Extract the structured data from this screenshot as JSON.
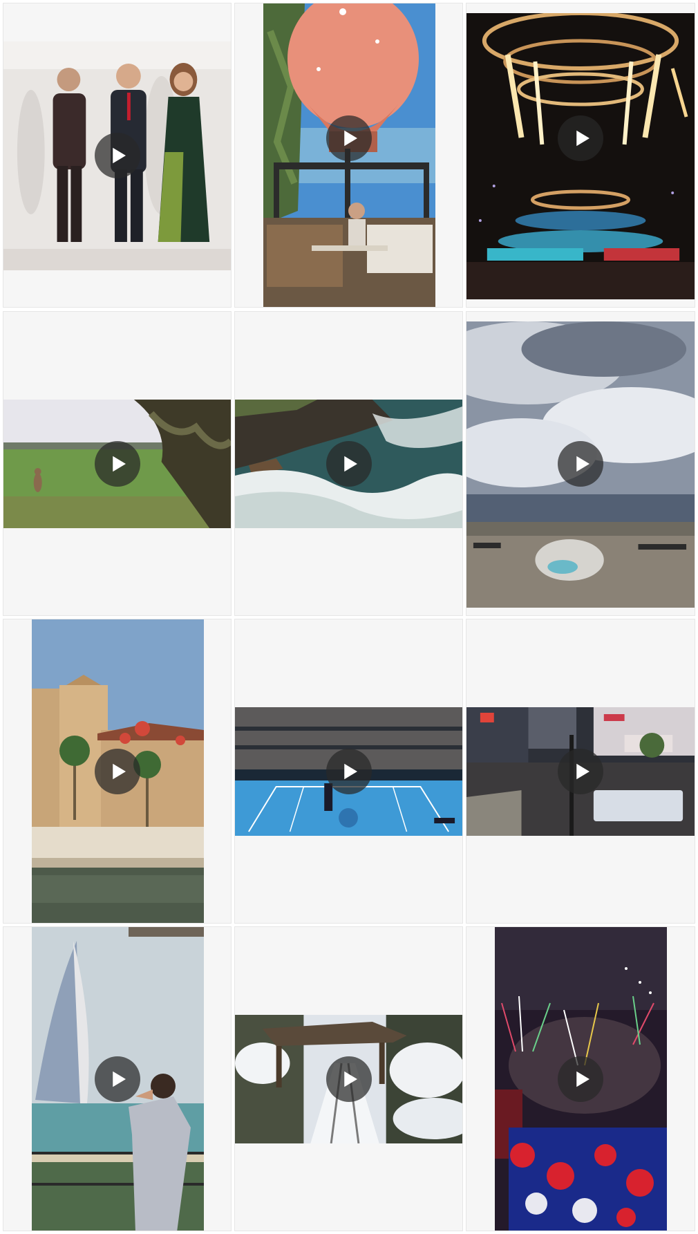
{
  "gallery": {
    "items": [
      {
        "kind": "video",
        "scene": "event-stage-trio"
      },
      {
        "kind": "video",
        "scene": "hot-air-balloon-dining"
      },
      {
        "kind": "video",
        "scene": "concert-fireworks-stage"
      },
      {
        "kind": "video",
        "scene": "kangaroo-field"
      },
      {
        "kind": "video",
        "scene": "ocean-coastline-aerial"
      },
      {
        "kind": "video",
        "scene": "geyser-cloudy-sky"
      },
      {
        "kind": "video",
        "scene": "waterfront-resort-palace"
      },
      {
        "kind": "video",
        "scene": "tennis-stadium"
      },
      {
        "kind": "video",
        "scene": "city-night-crossing"
      },
      {
        "kind": "video",
        "scene": "sail-hotel-balcony"
      },
      {
        "kind": "video",
        "scene": "snowy-funicular"
      },
      {
        "kind": "video",
        "scene": "fireworks-night-festival"
      }
    ]
  },
  "icons": {
    "play": "play-icon"
  },
  "colors": {
    "cell_bg": "#f6f6f6",
    "play_bg": "#282828"
  }
}
